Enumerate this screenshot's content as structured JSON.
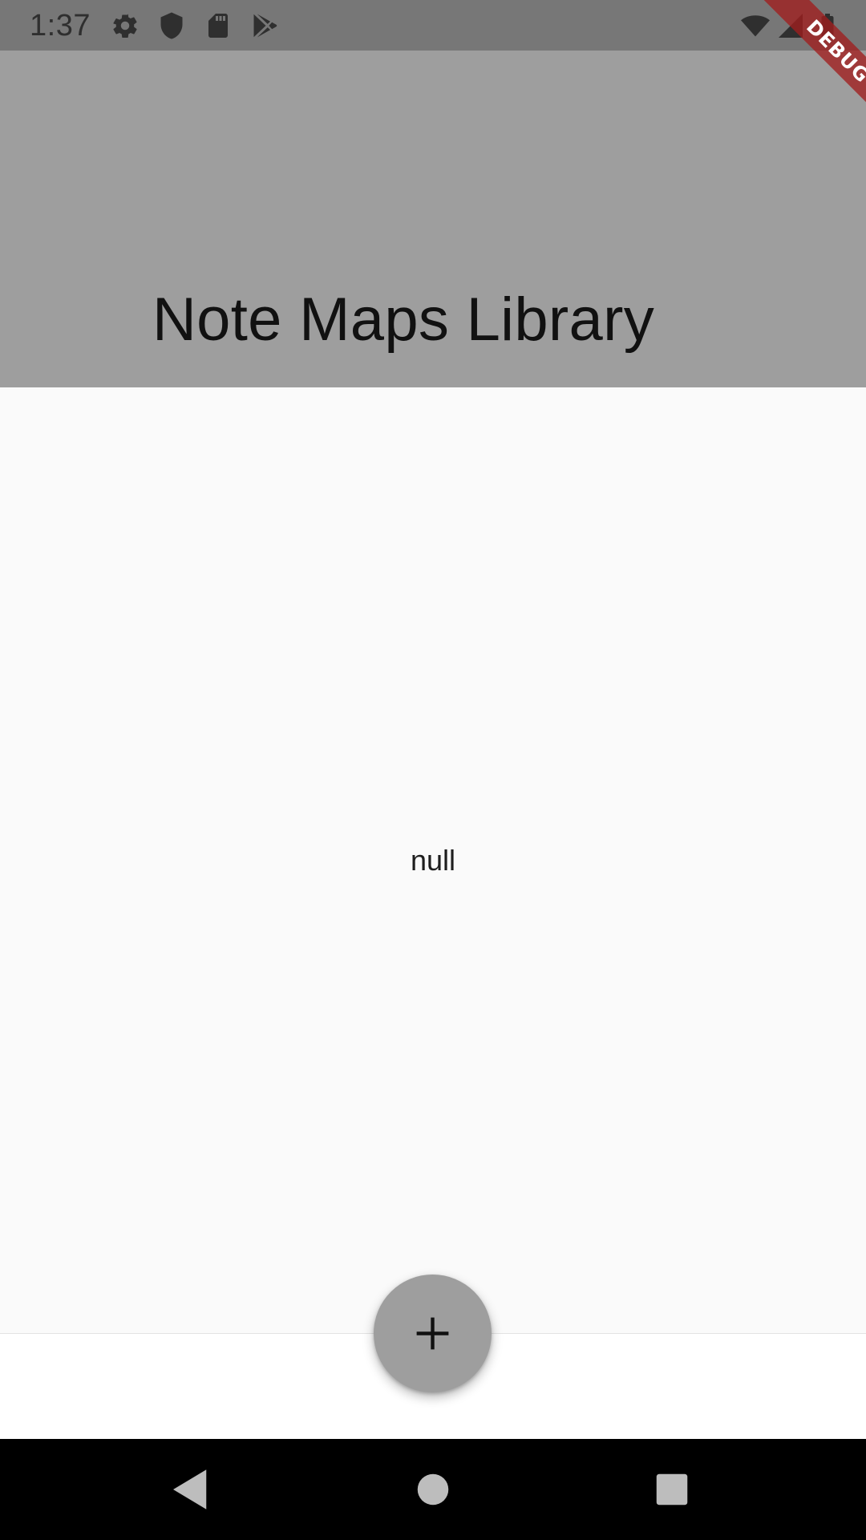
{
  "status_bar": {
    "time": "1:37",
    "left_icons": [
      "settings-icon",
      "shield-icon",
      "sd-card-icon",
      "play-store-icon"
    ],
    "right_icons": [
      "wifi-icon",
      "signal-icon",
      "battery-icon"
    ]
  },
  "app_bar": {
    "title": "Note Maps Library"
  },
  "body": {
    "center_text": "null"
  },
  "fab": {
    "icon": "plus-icon"
  },
  "debug_banner": {
    "label": "DEBUG"
  },
  "nav_bar": {
    "buttons": [
      "back-icon",
      "home-icon",
      "recents-icon"
    ]
  },
  "colors": {
    "status_bar": "#777777",
    "app_bar": "#9e9e9e",
    "body": "#fafafa",
    "fab": "#9e9e9e",
    "debug": "#a01e1e"
  }
}
